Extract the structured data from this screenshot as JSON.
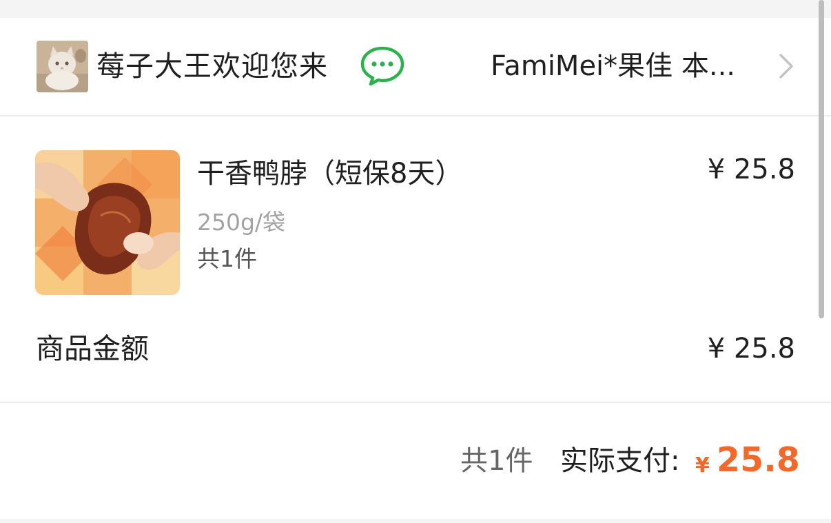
{
  "store": {
    "user_name": "莓子大王欢迎您来",
    "shop_name": "FamiMei*果佳 本..."
  },
  "item": {
    "name": "干香鸭脖（短保8天）",
    "price": "¥ 25.8",
    "spec": "250g/袋",
    "quantity": "共1件"
  },
  "summary": {
    "goods_amount_label": "商品金额",
    "goods_amount_value": "¥ 25.8"
  },
  "footer": {
    "count": "共1件",
    "paid_label": "实际支付:",
    "currency": "¥",
    "total": "25.8"
  },
  "colors": {
    "accent": "#f2692b",
    "wechat_green": "#2bb24c"
  },
  "icons": [
    "avatar-cat",
    "chat-icon",
    "chevron-right-icon"
  ]
}
